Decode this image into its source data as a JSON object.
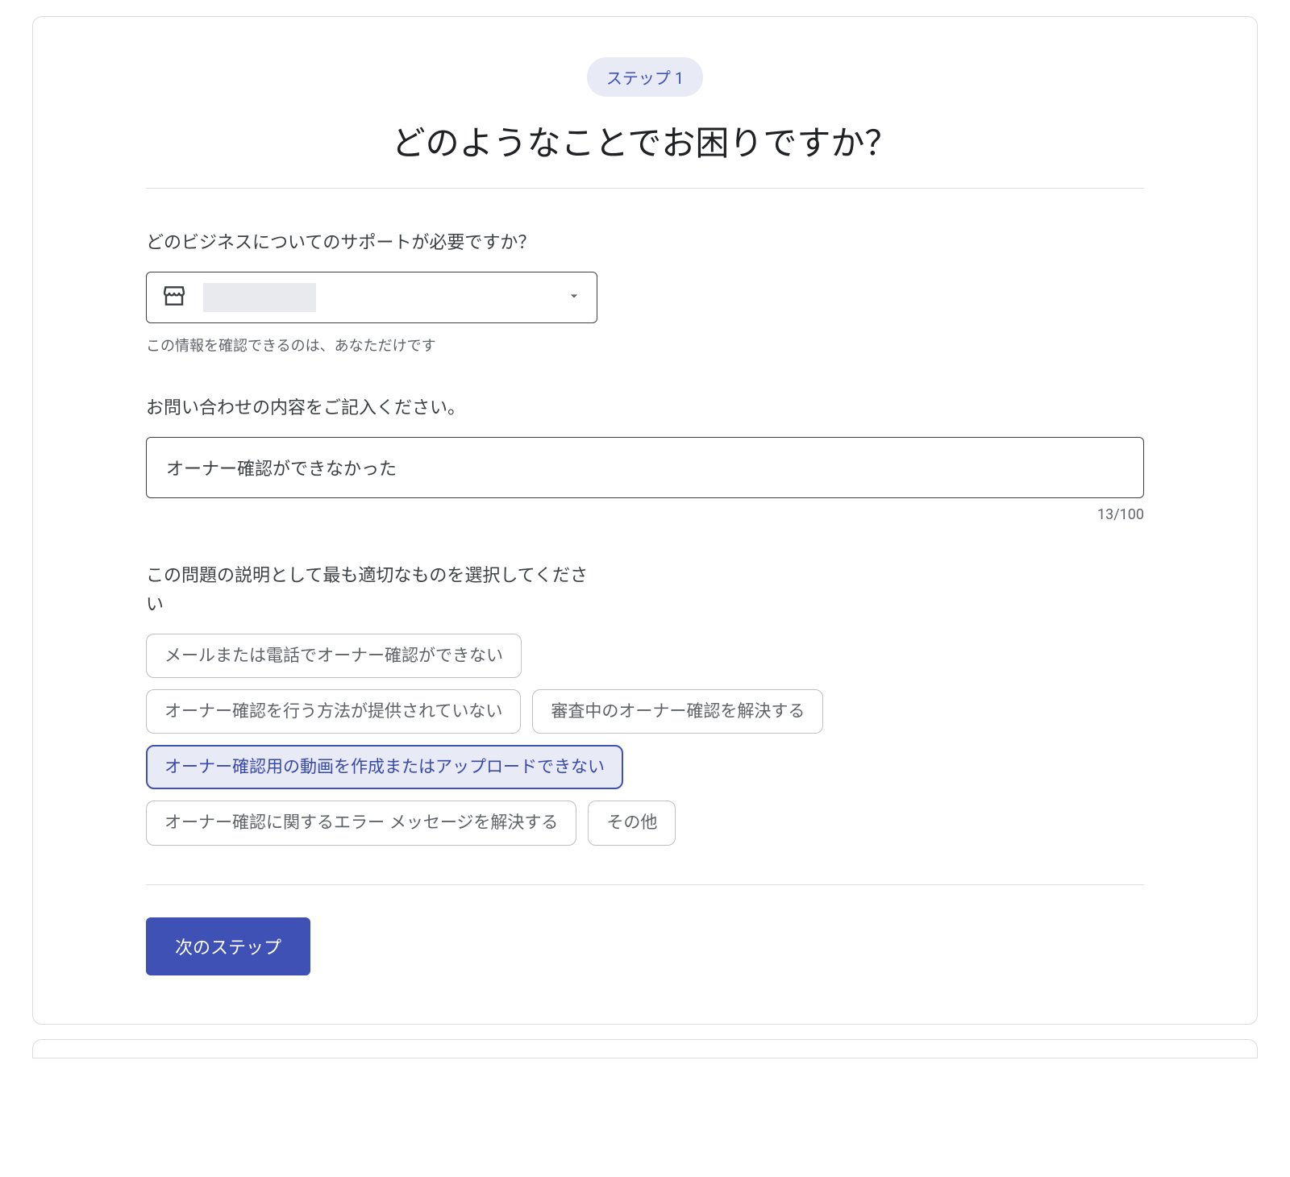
{
  "step": {
    "badge": "ステップ 1",
    "title": "どのようなことでお困りですか？"
  },
  "business": {
    "label": "どのビジネスについてのサポートが必要ですか？",
    "helper": "この情報を確認できるのは、あなただけです"
  },
  "inquiry": {
    "label": "お問い合わせの内容をご記入ください。",
    "value": "オーナー確認ができなかった",
    "count": "13/100"
  },
  "problem": {
    "label": "この問題の説明として最も適切なものを選択してください",
    "options": {
      "o1": "メールまたは電話でオーナー確認ができない",
      "o2": "オーナー確認を行う方法が提供されていない",
      "o3": "審査中のオーナー確認を解決する",
      "o4": "オーナー確認用の動画を作成またはアップロードできない",
      "o5": "オーナー確認に関するエラー メッセージを解決する",
      "o6": "その他"
    }
  },
  "actions": {
    "next": "次のステップ"
  }
}
